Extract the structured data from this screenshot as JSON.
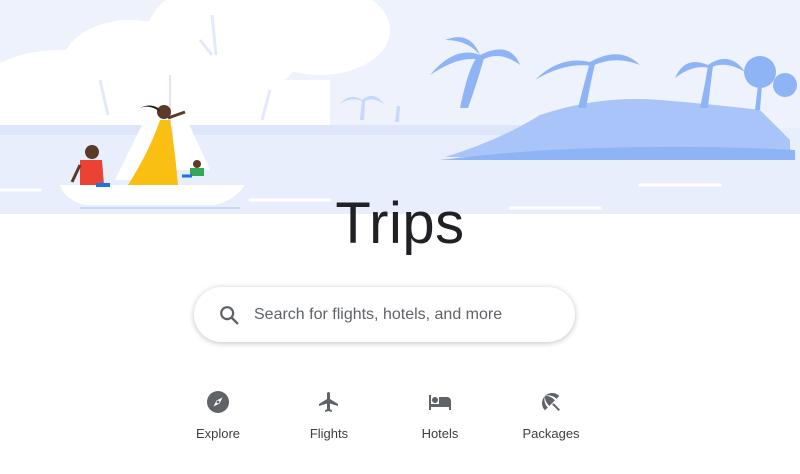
{
  "page": {
    "title": "Trips"
  },
  "search": {
    "placeholder": "Search for flights, hotels, and more"
  },
  "nav": {
    "items": [
      {
        "label": "Explore",
        "icon": "compass-icon"
      },
      {
        "label": "Flights",
        "icon": "airplane-icon"
      },
      {
        "label": "Hotels",
        "icon": "bed-icon"
      },
      {
        "label": "Packages",
        "icon": "beach-umbrella-icon"
      }
    ]
  },
  "colors": {
    "title_text": "#202124",
    "icon": "#5f6368",
    "hero_light": "#e8eefc",
    "hero_mid": "#c6d8fb",
    "hero_blue": "#8fb4f6",
    "dress_yellow": "#f9c013",
    "shirt_red": "#ea4335",
    "kid_green": "#34a853"
  }
}
